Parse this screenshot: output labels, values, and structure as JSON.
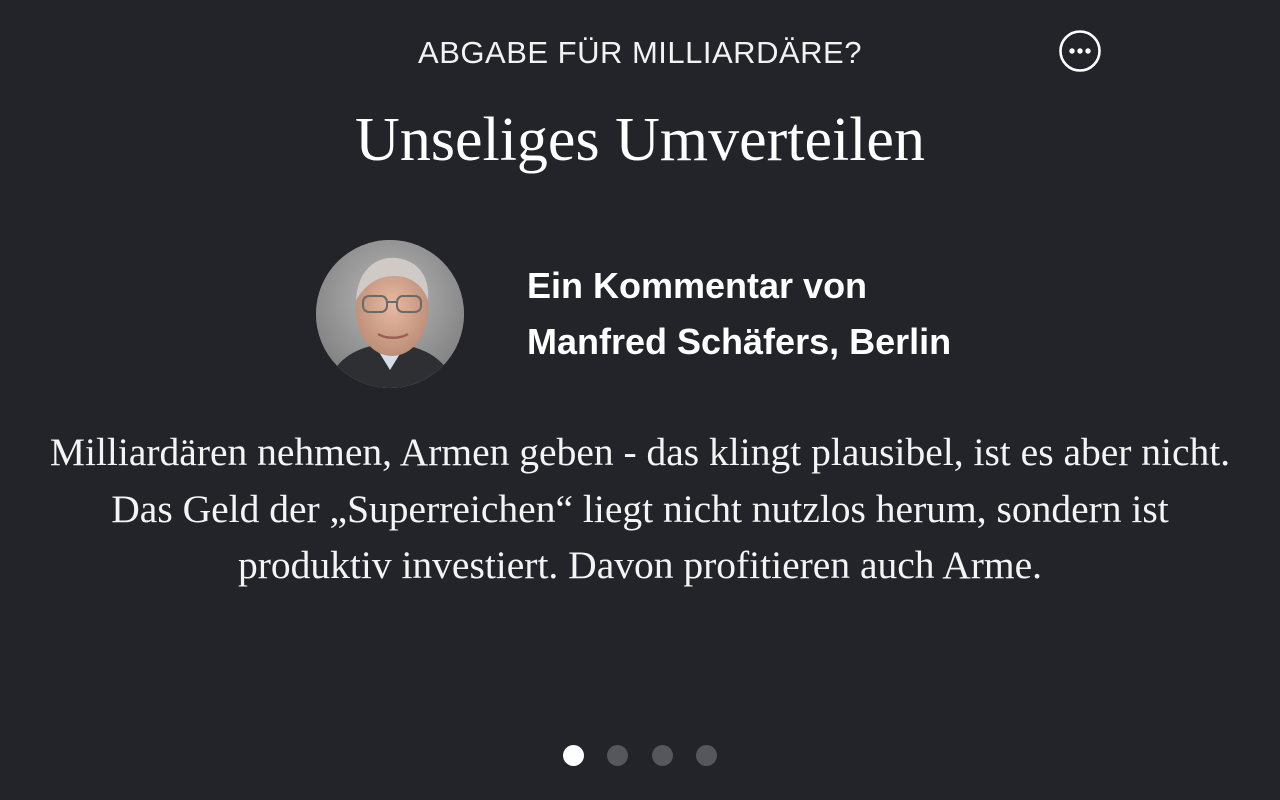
{
  "article": {
    "kicker": "ABGABE FÜR MILLIARDÄRE?",
    "title": "Unseliges Umverteilen",
    "byline_line1": "Ein Kommentar von",
    "byline_line2": "Manfred Schäfers, Berlin",
    "teaser": "Milliardären nehmen, Armen geben - das klingt plausibel, ist es aber nicht. Das Geld der „Superreichen“ liegt nicht nutzlos herum, sondern ist produktiv investiert. Davon profitieren auch Arme."
  },
  "toolbar": {
    "more_icon": "more-horizontal-circle-icon"
  },
  "author": {
    "photo": "author-portrait"
  },
  "pager": {
    "total": 4,
    "active_index": 0
  },
  "colors": {
    "background": "#222429",
    "text": "#ffffff",
    "dot_inactive": "#55575c",
    "dot_active": "#ffffff"
  }
}
